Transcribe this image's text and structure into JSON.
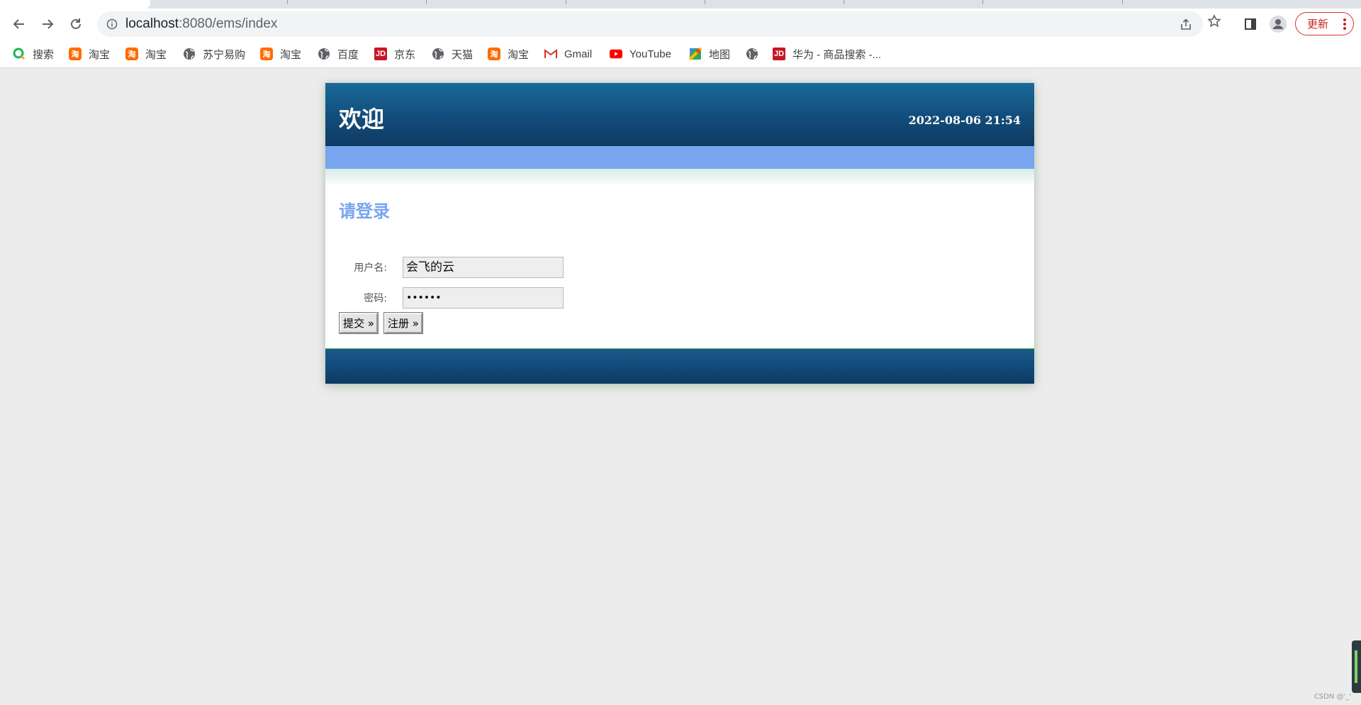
{
  "browser": {
    "url_host": "localhost",
    "url_path": ":8080/ems/index",
    "update_label": "更新"
  },
  "bookmarks": [
    {
      "label": "搜索",
      "icon": "360-search-icon"
    },
    {
      "label": "淘宝",
      "icon": "taobao-icon"
    },
    {
      "label": "淘宝",
      "icon": "taobao-icon"
    },
    {
      "label": "苏宁易购",
      "icon": "globe-icon"
    },
    {
      "label": "淘宝",
      "icon": "taobao-icon"
    },
    {
      "label": "百度",
      "icon": "globe-icon"
    },
    {
      "label": "京东",
      "icon": "jd-icon"
    },
    {
      "label": "天猫",
      "icon": "globe-icon"
    },
    {
      "label": "淘宝",
      "icon": "taobao-icon"
    },
    {
      "label": "Gmail",
      "icon": "gmail-icon"
    },
    {
      "label": "YouTube",
      "icon": "youtube-icon"
    },
    {
      "label": "地图",
      "icon": "maps-icon"
    },
    {
      "label": "",
      "icon": "globe-icon"
    },
    {
      "label": "华为 - 商品搜索 -...",
      "icon": "jd-icon"
    }
  ],
  "page": {
    "site_title": "欢迎",
    "datetime": "2022-08-06 21:54",
    "login_heading": "请登录",
    "username_label": "用户名:",
    "username_value": "会飞的云",
    "password_label": "密码:",
    "password_value": "••••••",
    "submit_label": "提交 »",
    "register_label": "注册 »"
  },
  "watermark": "CSDN @'_'",
  "colors": {
    "header_blue": "#124c7a",
    "nav_blue": "#77a6ee",
    "heading_blue": "#77a6ee",
    "update_red": "#d93025"
  }
}
